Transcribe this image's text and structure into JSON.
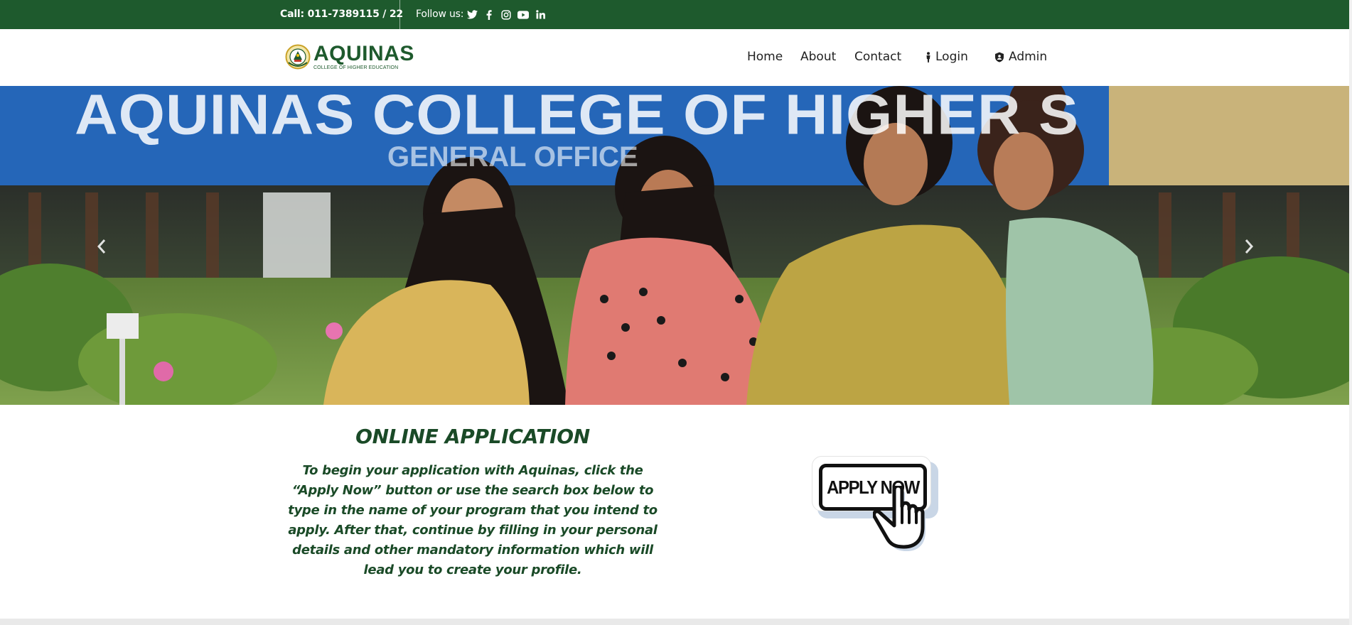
{
  "topbar": {
    "call": "Call: 011-7389115 / 22",
    "follow_label": "Follow us:",
    "social": [
      "twitter-icon",
      "facebook-icon",
      "instagram-icon",
      "youtube-icon",
      "linkedin-icon"
    ]
  },
  "brand": {
    "name": "AQUINAS",
    "tagline": "COLLEGE OF HIGHER EDUCATION"
  },
  "nav": {
    "home": "Home",
    "about": "About",
    "contact": "Contact",
    "login": "Login",
    "admin": "Admin"
  },
  "hero": {
    "sign_text": "AQUINAS COLLEGE OF HIGHER S",
    "sign_sub": "GENERAL OFFICE"
  },
  "application": {
    "title": "ONLINE APPLICATION",
    "body": "To begin your application with Aquinas, click the “Apply Now” button or use the search box below to type in the name of your program that you intend to apply. After that, continue by filling in your personal details and other mandatory information which will lead you to create your profile.",
    "apply_label": "APPLY NOW"
  },
  "colors": {
    "brand_green": "#1e5a2d",
    "text_green": "#1a4a27",
    "hero_blue": "#2566b8"
  }
}
